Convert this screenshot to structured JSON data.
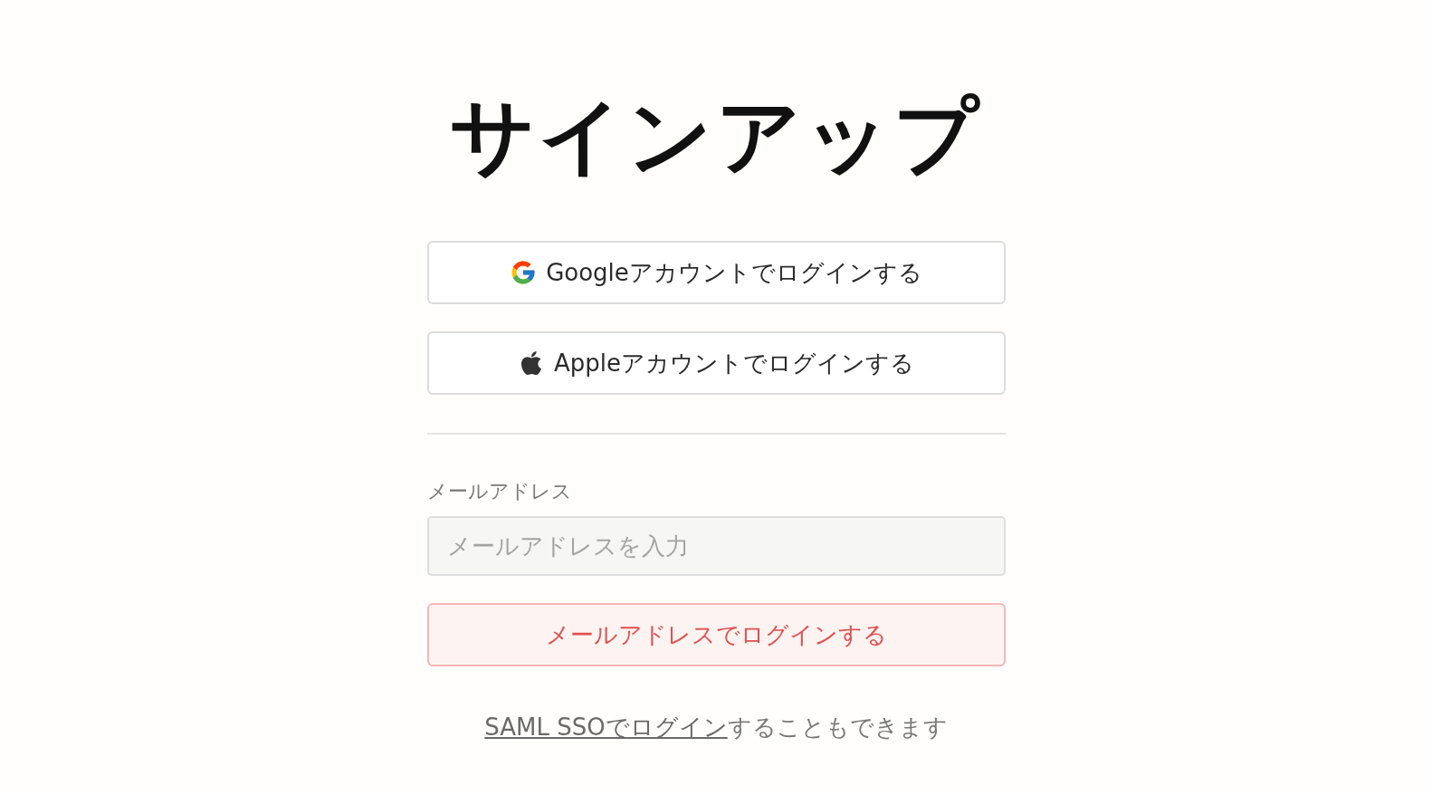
{
  "title": "サインアップ",
  "oauth_buttons": [
    {
      "kind": "google",
      "label": "Googleアカウントでログインする"
    },
    {
      "kind": "apple",
      "label": "Appleアカウントでログインする"
    }
  ],
  "email": {
    "label": "メールアドレス",
    "placeholder": "メールアドレスを入力"
  },
  "submit_button": "メールアドレスでログインする",
  "sso": {
    "link": "SAML SSOでログイン",
    "text": "することもできます"
  }
}
